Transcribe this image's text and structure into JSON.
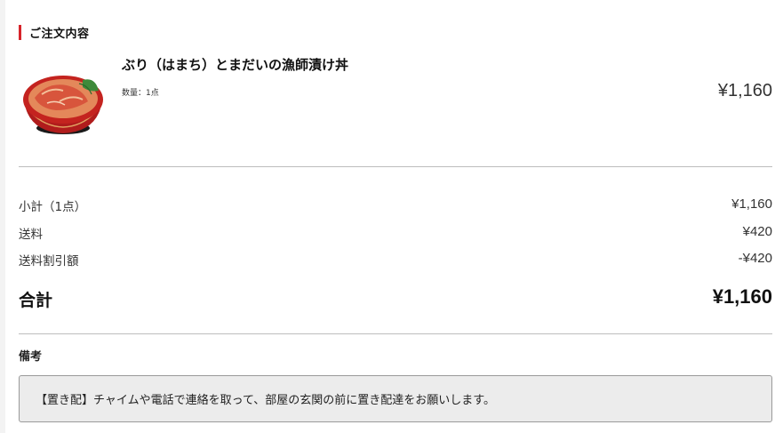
{
  "order_section": {
    "title": "ご注文内容",
    "accent_color": "#d7242b"
  },
  "items": [
    {
      "image": "donburi-bowl-icon",
      "name": "ぶり（はまち）とまだいの漁師漬け丼",
      "quantity": "数量：1点",
      "price": "¥1,160"
    }
  ],
  "summary": {
    "subtotal_label": "小計（1点）",
    "subtotal_value": "¥1,160",
    "shipping_label": "送料",
    "shipping_value": "¥420",
    "shipping_discount_label": "送料割引額",
    "shipping_discount_value": "-¥420",
    "total_label": "合計",
    "total_value": "¥1,160"
  },
  "notes": {
    "title": "備考",
    "text": "【置き配】チャイムや電話で連絡を取って、部屋の玄関の前に置き配達をお願いします。"
  }
}
